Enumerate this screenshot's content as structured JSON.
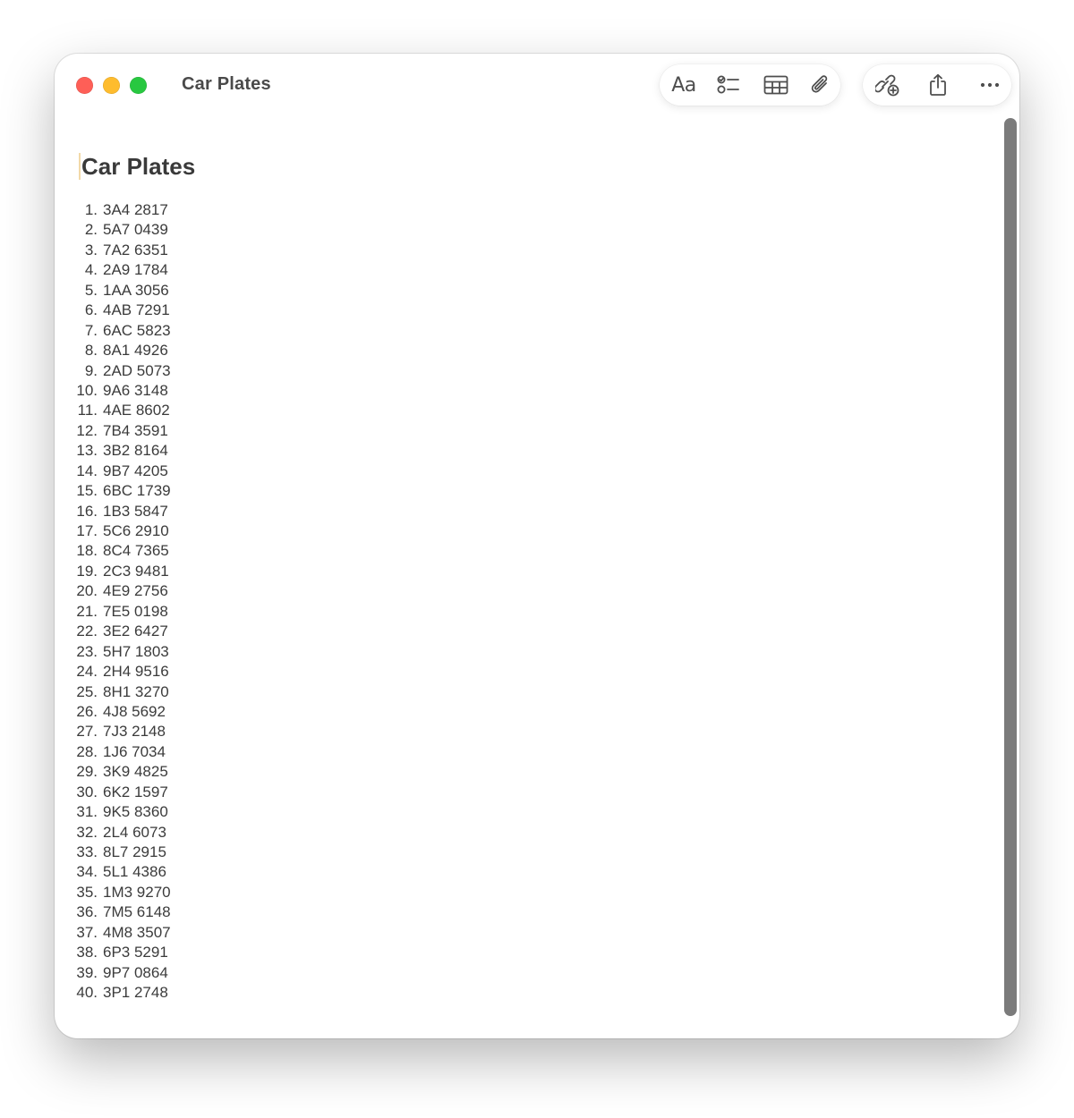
{
  "window": {
    "title": "Car Plates"
  },
  "toolbar": {
    "format_label": "Aa",
    "checklist_icon": "checklist-icon",
    "table_icon": "table-icon",
    "attachment_icon": "paperclip-icon",
    "collaborate_icon": "collaborate-icon",
    "share_icon": "share-icon",
    "more_icon": "ellipsis-icon"
  },
  "note": {
    "title": "Car Plates",
    "plates": [
      {
        "n": "1.",
        "plate": "3A4 2817"
      },
      {
        "n": "2.",
        "plate": "5A7 0439"
      },
      {
        "n": "3.",
        "plate": "7A2 6351"
      },
      {
        "n": "4.",
        "plate": "2A9 1784"
      },
      {
        "n": "5.",
        "plate": "1AA 3056"
      },
      {
        "n": "6.",
        "plate": "4AB 7291"
      },
      {
        "n": "7.",
        "plate": "6AC 5823"
      },
      {
        "n": "8.",
        "plate": "8A1 4926"
      },
      {
        "n": "9.",
        "plate": "2AD 5073"
      },
      {
        "n": "10.",
        "plate": "9A6 3148"
      },
      {
        "n": "11.",
        "plate": "4AE 8602"
      },
      {
        "n": "12.",
        "plate": "7B4 3591"
      },
      {
        "n": "13.",
        "plate": "3B2 8164"
      },
      {
        "n": "14.",
        "plate": "9B7 4205"
      },
      {
        "n": "15.",
        "plate": "6BC 1739"
      },
      {
        "n": "16.",
        "plate": "1B3 5847"
      },
      {
        "n": "17.",
        "plate": "5C6 2910"
      },
      {
        "n": "18.",
        "plate": "8C4 7365"
      },
      {
        "n": "19.",
        "plate": "2C3 9481"
      },
      {
        "n": "20.",
        "plate": "4E9 2756"
      },
      {
        "n": "21.",
        "plate": "7E5 0198"
      },
      {
        "n": "22.",
        "plate": "3E2 6427"
      },
      {
        "n": "23.",
        "plate": "5H7 1803"
      },
      {
        "n": "24.",
        "plate": "2H4 9516"
      },
      {
        "n": "25.",
        "plate": "8H1 3270"
      },
      {
        "n": "26.",
        "plate": "4J8 5692"
      },
      {
        "n": "27.",
        "plate": "7J3 2148"
      },
      {
        "n": "28.",
        "plate": "1J6 7034"
      },
      {
        "n": "29.",
        "plate": "3K9 4825"
      },
      {
        "n": "30.",
        "plate": "6K2 1597"
      },
      {
        "n": "31.",
        "plate": "9K5 8360"
      },
      {
        "n": "32.",
        "plate": "2L4 6073"
      },
      {
        "n": "33.",
        "plate": "8L7 2915"
      },
      {
        "n": "34.",
        "plate": "5L1 4386"
      },
      {
        "n": "35.",
        "plate": "1M3 9270"
      },
      {
        "n": "36.",
        "plate": "7M5 6148"
      },
      {
        "n": "37.",
        "plate": "4M8 3507"
      },
      {
        "n": "38.",
        "plate": "6P3 5291"
      },
      {
        "n": "39.",
        "plate": "9P7 0864"
      },
      {
        "n": "40.",
        "plate": "3P1 2748"
      }
    ]
  },
  "colors": {
    "close": "#fe5f57",
    "minimize": "#febc2e",
    "maximize": "#28c840",
    "scrollbar": "#7b7b7b"
  }
}
